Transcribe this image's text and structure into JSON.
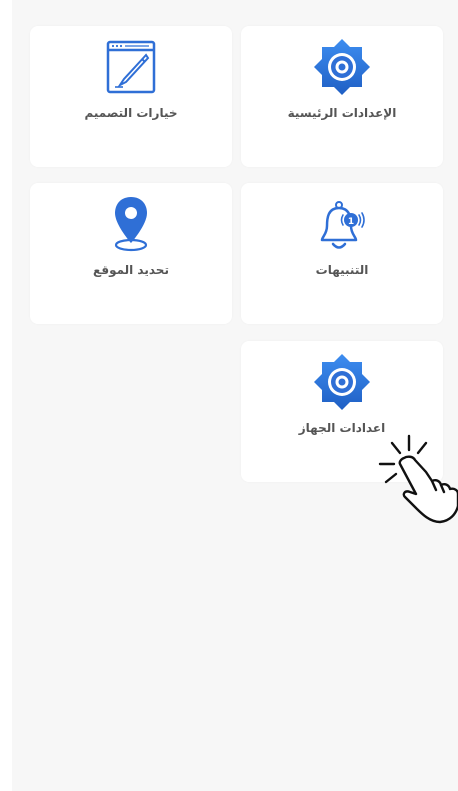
{
  "tiles": {
    "main_settings": {
      "label": "الإعدادات الرئيسية",
      "icon": "gear-icon"
    },
    "design_options": {
      "label": "خيارات التصميم",
      "icon": "design-pen-icon"
    },
    "notifications": {
      "label": "التنبيهات",
      "icon": "bell-icon"
    },
    "location": {
      "label": "تحديد الموقع",
      "icon": "map-pin-icon"
    },
    "device_settings": {
      "label": "اعدادات الجهاز",
      "icon": "gear-icon"
    }
  },
  "colors": {
    "accent_blue": "#2f6fd6",
    "background": "#f7f7f7",
    "card": "#ffffff",
    "label_text": "#555555"
  },
  "overlay": {
    "icon": "tap-hand-cursor-icon"
  }
}
